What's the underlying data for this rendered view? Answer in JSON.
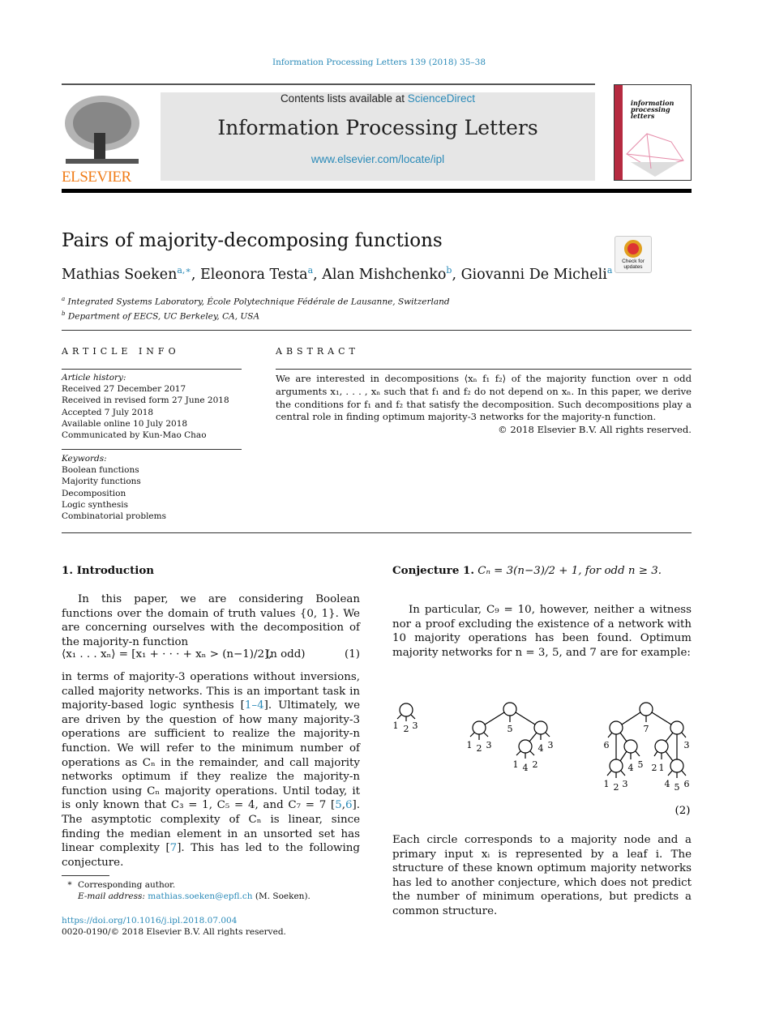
{
  "journal_ref": "Information Processing Letters 139 (2018) 35–38",
  "header": {
    "contents_prefix": "Contents lists available at ",
    "sciencedirect": "ScienceDirect",
    "journal": "Information Processing Letters",
    "url": "www.elsevier.com/locate/ipl",
    "publisher_logo": "ELSEVIER",
    "cover_title": "information processing letters"
  },
  "title": "Pairs of majority-decomposing functions",
  "check_updates": "Check for updates",
  "authors": [
    {
      "name": "Mathias Soeken",
      "sup": "a,∗"
    },
    {
      "name": "Eleonora Testa",
      "sup": "a"
    },
    {
      "name": "Alan Mishchenko",
      "sup": "b"
    },
    {
      "name": "Giovanni De Micheli",
      "sup": "a"
    }
  ],
  "affiliations": [
    {
      "mark": "a",
      "text": "Integrated Systems Laboratory, École Polytechnique Fédérale de Lausanne, Switzerland"
    },
    {
      "mark": "b",
      "text": "Department of EECS, UC Berkeley, CA, USA"
    }
  ],
  "article_info": {
    "heading": "ARTICLE INFO",
    "history_label": "Article history:",
    "history": [
      "Received 27 December 2017",
      "Received in revised form 27 June 2018",
      "Accepted 7 July 2018",
      "Available online 10 July 2018",
      "Communicated by Kun-Mao Chao"
    ],
    "keywords_label": "Keywords:",
    "keywords": [
      "Boolean functions",
      "Majority functions",
      "Decomposition",
      "Logic synthesis",
      "Combinatorial problems"
    ]
  },
  "abstract": {
    "heading": "ABSTRACT",
    "text": "We are interested in decompositions ⟨xₙ f₁ f₂⟩ of the majority function over n odd arguments x₁, . . . , xₙ such that f₁ and f₂ do not depend on xₙ. In this paper, we derive the conditions for f₁ and f₂ that satisfy the decomposition. Such decompositions play a central role in finding optimum majority-3 networks for the majority-n function.",
    "copyright": "© 2018 Elsevier B.V. All rights reserved."
  },
  "intro": {
    "heading": "1.  Introduction",
    "p1": "In this paper, we are considering Boolean functions over the domain of truth values {0, 1}. We are concerning ourselves with the decomposition of the majority-n function",
    "eq1": "⟨x₁ . . . xₙ⟩ = [x₁ + · · · + xₙ > (n−1)/2],",
    "eq1_cond": "(n odd)",
    "eq1_num": "(1)",
    "p2": [
      "in terms of majority-3 operations without inversions, called majority networks. This is an important task in majority-based logic synthesis [",
      "1–4",
      "]. Ultimately, we are driven by the question of how many majority-3 operations are sufficient to realize the majority-n function. We will refer to the minimum number of operations as Cₙ in the remainder, and call majority networks optimum if they realize the majority-n function using Cₙ majority operations. Until today, it is only known that C₃ = 1, C₅ = 4, and C₇ = 7 [",
      "5",
      ",",
      "6",
      "]. The asymptotic complexity of Cₙ is linear, since finding the median element in an unsorted set has linear complexity [",
      "7",
      "]. This has led to the following conjecture."
    ]
  },
  "conjecture": {
    "label": "Conjecture 1.",
    "text": "Cₙ = 3(n−3)/2 + 1, for odd n ≥ 3."
  },
  "right_p1": "In particular, C₉ = 10, however, neither a witness nor a proof excluding the existence of a network with 10 majority operations has been found. Optimum majority networks for n = 3, 5, and 7 are for example:",
  "trees": {
    "t1": [
      "1",
      "2",
      "3"
    ],
    "t2": [
      "1",
      "2",
      "3",
      "5",
      "1",
      "4",
      "2",
      "4",
      "3"
    ],
    "t3": [
      "6",
      "7",
      "3",
      "1",
      "2",
      "3",
      "4",
      "5",
      "2",
      "1",
      "4",
      "5",
      "6"
    ],
    "eq_num": "(2)"
  },
  "right_p2": "Each circle corresponds to a majority node and a primary input xᵢ is represented by a leaf i. The structure of these known optimum majority networks has led to another conjecture, which does not predict the number of minimum operations, but predicts a common structure.",
  "footnote": {
    "mark": "*",
    "text": "Corresponding author.",
    "email_label": "E-mail address: ",
    "email": "mathias.soeken@epfl.ch",
    "email_suffix": " (M. Soeken)."
  },
  "doi": "https://doi.org/10.1016/j.ipl.2018.07.004",
  "issn": "0020-0190/© 2018 Elsevier B.V. All rights reserved.",
  "colors": {
    "link": "#2a8ab8",
    "elsevier_orange": "#f07d1a",
    "banner_bg": "#e6e6e6"
  }
}
